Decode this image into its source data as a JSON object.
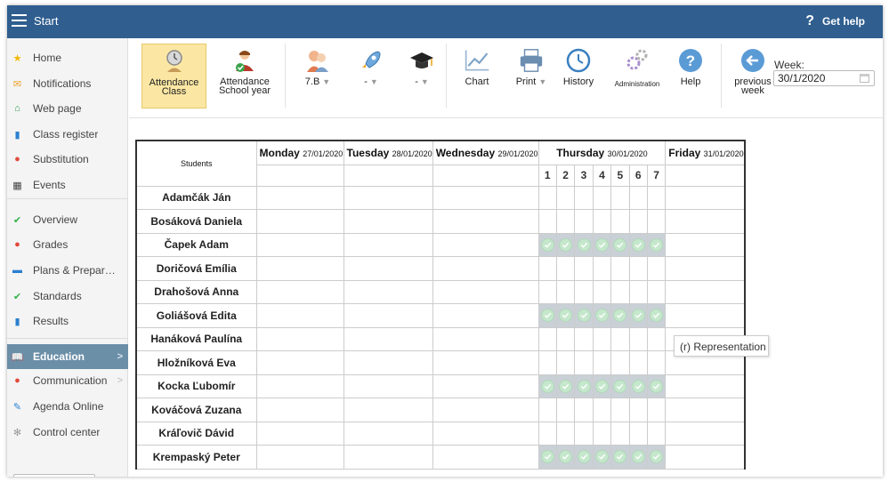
{
  "header": {
    "title": "Start",
    "help_label": "Get help",
    "help_icon": "?"
  },
  "sidebar": {
    "items": [
      {
        "label": "Home",
        "icon": "star-icon",
        "color": "#f5b600"
      },
      {
        "label": "Notifications",
        "icon": "envelope-icon",
        "color": "#f0a028"
      },
      {
        "label": "Web page",
        "icon": "house-icon",
        "color": "#2e9a4e"
      },
      {
        "label": "Class register",
        "icon": "book-icon",
        "color": "#2a7fd0"
      },
      {
        "label": "Substitution",
        "icon": "person-icon",
        "color": "#e04a3a"
      },
      {
        "label": "Events",
        "icon": "calendar-icon",
        "color": "#444444"
      },
      {
        "label": "Overview",
        "icon": "check-circle-icon",
        "color": "#33b24a"
      },
      {
        "label": "Grades",
        "icon": "grades-icon",
        "color": "#e04a3a"
      },
      {
        "label": "Plans & Preparations",
        "icon": "briefcase-icon",
        "color": "#2a7fd0"
      },
      {
        "label": "Standards",
        "icon": "shield-icon",
        "color": "#33b24a"
      },
      {
        "label": "Results",
        "icon": "bar-chart-icon",
        "color": "#2a7fd0"
      },
      {
        "label": "Education",
        "icon": "open-book-icon",
        "color": "#ffffff",
        "active": true
      },
      {
        "label": "Communication",
        "icon": "chat-icon",
        "color": "#e04a3a"
      },
      {
        "label": "Agenda Online",
        "icon": "pen-icon",
        "color": "#2a7fd0"
      },
      {
        "label": "Control center",
        "icon": "gear-icon",
        "color": "#999999"
      }
    ]
  },
  "toolbar": {
    "attendance_class": [
      "Attendance",
      "Class"
    ],
    "attendance_year": [
      "Attendance",
      "School year"
    ],
    "class_select": "7.B",
    "select_2": "-",
    "select_3": "-",
    "chart": "Chart",
    "print": "Print",
    "history": "History",
    "administration": "Administration",
    "help": "Help",
    "previous_week": [
      "previous",
      "week"
    ],
    "week_label": "Week:",
    "week_value": "30/1/2020"
  },
  "table": {
    "students_header": "Students",
    "days": [
      {
        "name": "Monday",
        "date": "27/01/2020"
      },
      {
        "name": "Tuesday",
        "date": "28/01/2020"
      },
      {
        "name": "Wednesday",
        "date": "29/01/2020"
      },
      {
        "name": "Thursday",
        "date": "30/01/2020"
      },
      {
        "name": "Friday",
        "date": "31/01/2020"
      }
    ],
    "periods": [
      "1",
      "2",
      "3",
      "4",
      "5",
      "6",
      "7"
    ],
    "students": [
      {
        "name": "Adamčák Ján",
        "present": false
      },
      {
        "name": "Bosáková Daniela",
        "present": false
      },
      {
        "name": "Čapek Adam",
        "present": true
      },
      {
        "name": "Doričová Emília",
        "present": false
      },
      {
        "name": "Drahošová Anna",
        "present": false
      },
      {
        "name": "Goliášová Edita",
        "present": true
      },
      {
        "name": "Hanáková Paulína",
        "present": false
      },
      {
        "name": "Hložníková Eva",
        "present": false
      },
      {
        "name": "Kocka Ľubomír",
        "present": true
      },
      {
        "name": "Kováčová Zuzana",
        "present": false
      },
      {
        "name": "Kráľovič Dávid",
        "present": false
      },
      {
        "name": "Krempaský Peter",
        "present": true
      }
    ]
  },
  "tooltip": "(r) Representation",
  "colors": {
    "topbar": "#2f5e8f",
    "active_sidebar": "#6c8fa8",
    "selected_button": "#fbe7a3",
    "check": "#c5e7cc",
    "highlight_row": "#c9d0d6"
  }
}
